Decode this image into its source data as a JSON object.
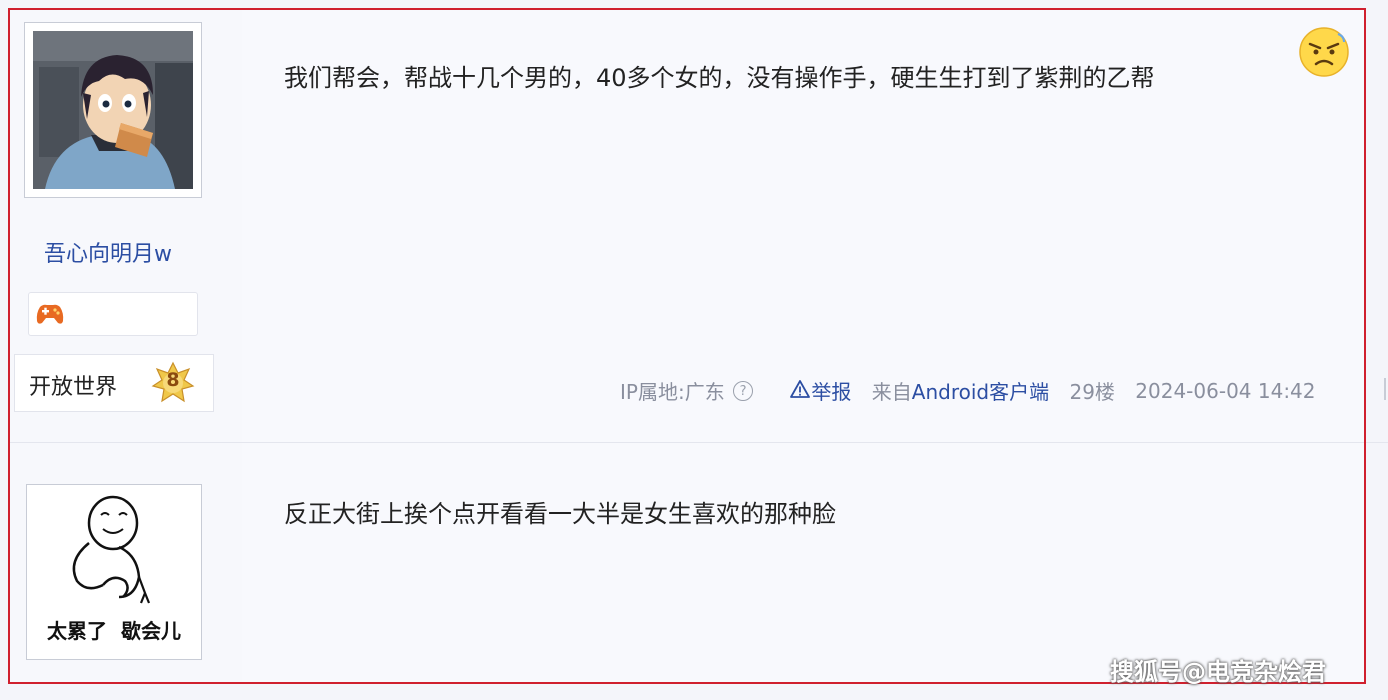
{
  "post1": {
    "username": "吾心向明月w",
    "level_name": "开放世界",
    "level_number": "8",
    "text": "我们帮会，帮战十几个男的，40多个女的，没有操作手，硬生生打到了紫荆的乙帮",
    "meta": {
      "ip_location": "IP属地:广东",
      "help_glyph": "?",
      "report_label": "举报",
      "client_prefix": "来自",
      "client_name": "Android客户端",
      "floor": "29楼",
      "datetime": "2024-06-04 14:42"
    }
  },
  "post2": {
    "avatar_caption": "太累了  歇会儿",
    "text": "反正大街上挨个点开看看一大半是女生喜欢的那种脸"
  },
  "watermark": "搜狐号@电竞杂烩君",
  "colors": {
    "frame": "#d0202e",
    "link": "#2c4ea3",
    "meta_gray": "#8a8f9e",
    "background": "#f4f5fa"
  },
  "icons": [
    "angry-emoji-icon",
    "game-controller-icon",
    "level-star-icon",
    "help-icon",
    "warning-triangle-icon"
  ]
}
